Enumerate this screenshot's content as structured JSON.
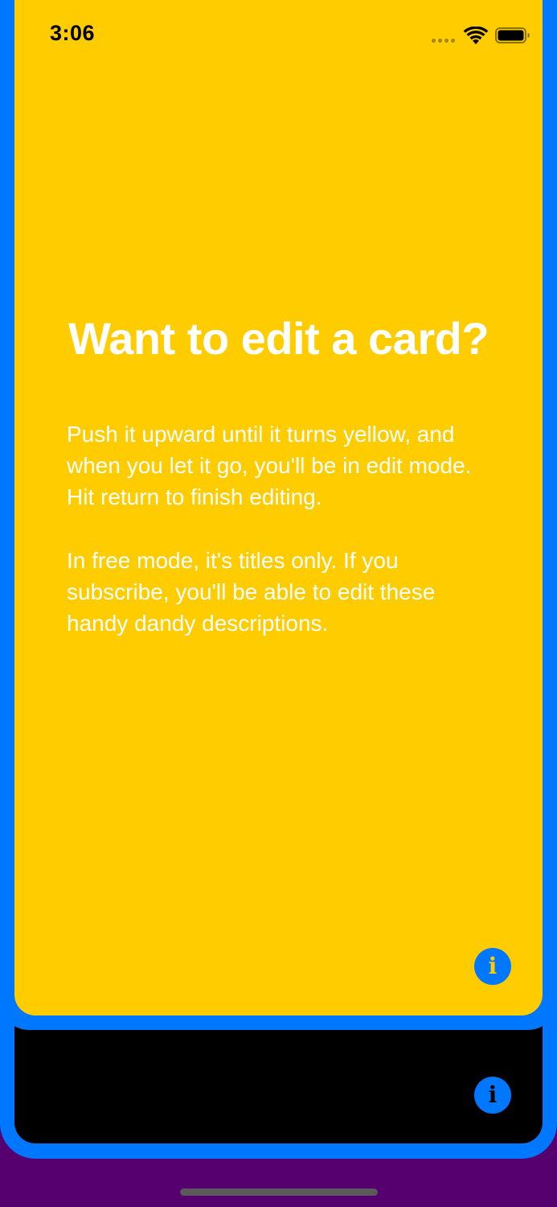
{
  "status_bar": {
    "time": "3:06",
    "wifi_icon": "wifi-icon",
    "battery_icon": "battery-icon"
  },
  "card": {
    "title": "Want to edit a card?",
    "paragraph_1": "Push it upward until it turns yellow, and when you let it go, you'll be in edit mode. Hit return to finish editing.",
    "paragraph_2": "In free mode, it's titles only. If you subscribe, you'll be able to edit these handy dandy descriptions.",
    "info_label": "i"
  },
  "back_card": {
    "info_label": "i"
  },
  "colors": {
    "card_yellow": "#FFCC00",
    "border_blue": "#0077FF",
    "background_purple": "#560070",
    "back_card_black": "#000000",
    "text_white": "#FFFFFF"
  }
}
